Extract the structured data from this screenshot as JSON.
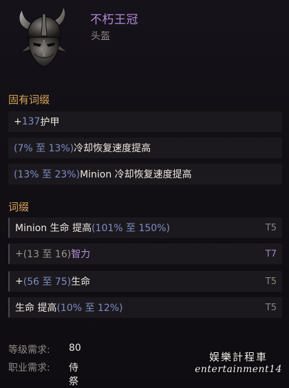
{
  "item": {
    "name": "不朽王冠",
    "type": "头盔",
    "icon": "horned-helmet-icon"
  },
  "implicit": {
    "title": "固有词缀",
    "rows": [
      {
        "prefix": "+",
        "range": "137",
        "text": " 护甲"
      },
      {
        "prefix": "",
        "range": "(7% 至 13%)",
        "text": " 冷却恢复速度提高"
      },
      {
        "prefix": "",
        "range": "(13% 至 23%)",
        "text": " Minion 冷却恢复速度提高"
      }
    ]
  },
  "affixes": {
    "title": "词缀",
    "rows": [
      {
        "before": "Minion 生命 提高 ",
        "range": "(101% 至 150%)",
        "after": "",
        "tier": "T5",
        "highlight": false
      },
      {
        "before": "+",
        "range": "(13 至 16)",
        "after": " 智力",
        "tier": "T7",
        "highlight": true
      },
      {
        "before": "+",
        "range": "(56 至 75)",
        "after": " 生命",
        "tier": "T5",
        "highlight": false
      },
      {
        "before": "生命 提高 ",
        "range": "(10% 至 12%)",
        "after": "",
        "tier": "T5",
        "highlight": false
      }
    ]
  },
  "requirements": {
    "level_label": "等级需求:",
    "level_value": "80",
    "class_label": "职业需求:",
    "class_value": "侍祭"
  },
  "watermark": {
    "cn": "娱樂計程車",
    "en": "entertainment14"
  },
  "colors": {
    "name": "#b48ad8",
    "section_title": "#d9a45a",
    "range": "#7d8fc6"
  }
}
